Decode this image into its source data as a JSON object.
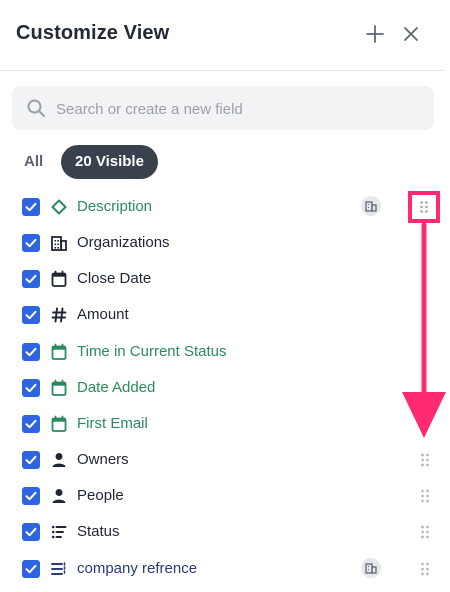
{
  "header": {
    "title": "Customize View",
    "add_icon": "plus-icon",
    "close_icon": "close-icon"
  },
  "search": {
    "placeholder": "Search or create a new field",
    "value": "",
    "icon": "search-icon"
  },
  "filters": {
    "all_label": "All",
    "visible_label": "20 Visible",
    "active": "visible"
  },
  "fields": [
    {
      "label": "Description",
      "icon": "diamond-icon",
      "checked": true,
      "color": "#2b8a5e",
      "badge": true
    },
    {
      "label": "Organizations",
      "icon": "building-icon",
      "checked": true,
      "color": "#1f2633",
      "badge": false
    },
    {
      "label": "Close Date",
      "icon": "calendar-icon",
      "checked": true,
      "color": "#1f2633",
      "badge": false
    },
    {
      "label": "Amount",
      "icon": "hash-icon",
      "checked": true,
      "color": "#1f2633",
      "badge": false
    },
    {
      "label": "Time in Current Status",
      "icon": "calendar-icon",
      "checked": true,
      "color": "#2b8a5e",
      "badge": false
    },
    {
      "label": "Date Added",
      "icon": "calendar-icon",
      "checked": true,
      "color": "#2b8a5e",
      "badge": false
    },
    {
      "label": "First Email",
      "icon": "calendar-icon",
      "checked": true,
      "color": "#2b8a5e",
      "badge": false
    },
    {
      "label": "Owners",
      "icon": "person-icon",
      "checked": true,
      "color": "#1f2633",
      "badge": false
    },
    {
      "label": "People",
      "icon": "person-icon",
      "checked": true,
      "color": "#1f2633",
      "badge": false
    },
    {
      "label": "Status",
      "icon": "list-icon",
      "checked": true,
      "color": "#1f2633",
      "badge": false
    },
    {
      "label": "company refrence",
      "icon": "list-icon",
      "checked": true,
      "color": "#2b3a7a",
      "badge": true
    }
  ],
  "colors": {
    "checkbox": "#2e64e0",
    "highlight": "#ff2a70",
    "pill": "#39414d"
  }
}
